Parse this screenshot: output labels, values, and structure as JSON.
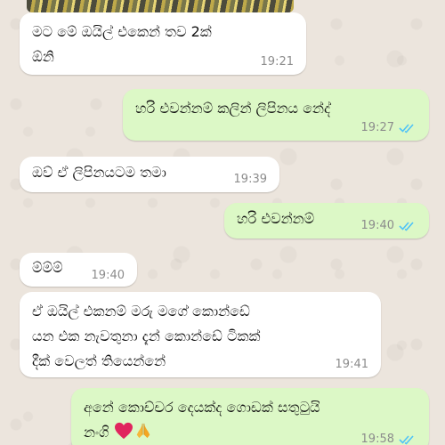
{
  "theme": {
    "wallpaper": "#ece5dd",
    "incoming_bubble": "#ffffff",
    "outgoing_bubble": "#dcf8c6",
    "read_tick_color": "#4fc3f7",
    "time_color": "#8c8c8c"
  },
  "messages": [
    {
      "dir": "in",
      "text": "මට මේ ඔයිල් එකෙන් තව 2ක්\nඕනි",
      "time": "19:21"
    },
    {
      "dir": "out",
      "text": "හරි එවන්නම් කලින් ලිපිනය නේද්",
      "time": "19:27",
      "status": "read"
    },
    {
      "dir": "in",
      "text": "ඔව් ඒ ලිපිනයටම තමා",
      "time": "19:39"
    },
    {
      "dir": "out",
      "text": "හරි එවන්නම්",
      "time": "19:40",
      "status": "read"
    },
    {
      "dir": "in",
      "text": "ම්ම්ම්",
      "time": "19:40"
    },
    {
      "dir": "in",
      "text": "ඒ ඔයිල් එකනම් මරු මගේ කොන්ඩේ\nයන එක නැවතුනා දැන් කොන්ඩේ ටිකක්\nදීක් වෙලත් තියෙන්නේ",
      "time": "19:41"
    },
    {
      "dir": "out",
      "text": "අනේ කොච්චර දෙයක්ද ගොඩක් සතුටුයි\nනංගි",
      "emoji": [
        "red-heart",
        "folded-hands"
      ],
      "time": "19:58",
      "status": "read"
    }
  ]
}
